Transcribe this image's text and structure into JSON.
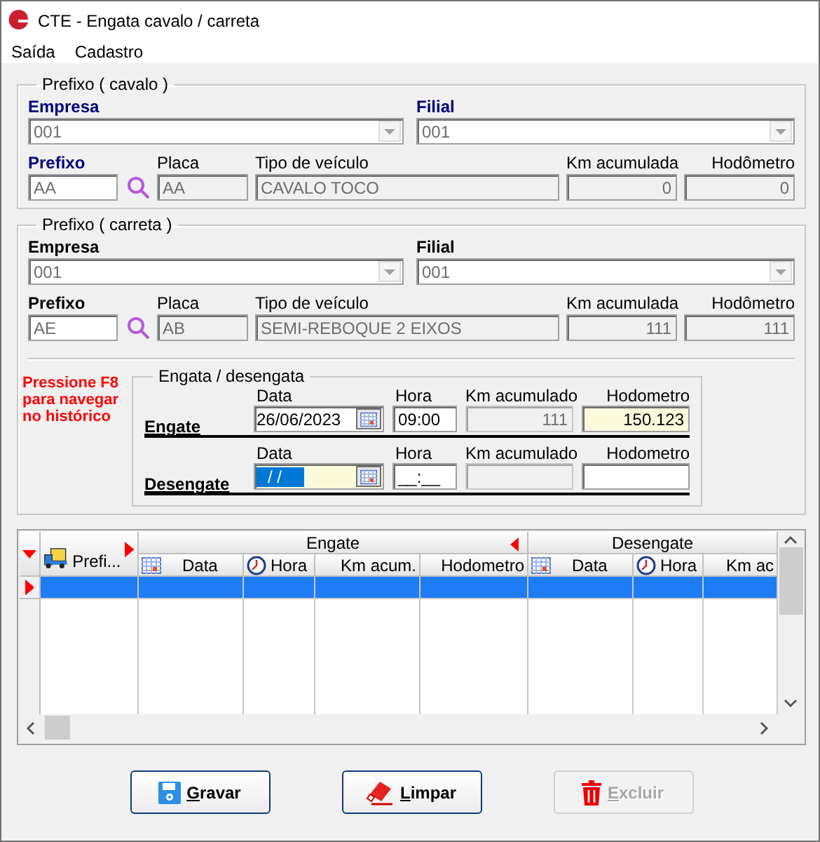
{
  "window": {
    "title": "CTE - Engata cavalo / carreta"
  },
  "menu": [
    {
      "label": "Saída"
    },
    {
      "label": "Cadastro"
    }
  ],
  "sections": [
    {
      "legend": "Prefixo ( cavalo )",
      "color": "#000080",
      "empresa": {
        "label": "Empresa",
        "value": "001",
        "required": true
      },
      "filial": {
        "label": "Filial",
        "value": "001",
        "required": true
      },
      "prefixo": {
        "label": "Prefixo",
        "value": "AA",
        "required": true,
        "editable": true
      },
      "placa": {
        "label": "Placa",
        "value": "AA",
        "required": false,
        "editable": false
      },
      "tipo_veiculo": {
        "label": "Tipo de veículo",
        "value": "CAVALO TOCO",
        "required": false,
        "editable": false
      },
      "km_acumulada": {
        "label": "Km acumulada",
        "value": "0",
        "required": false,
        "editable": false
      },
      "hodometro": {
        "label": "Hodômetro",
        "value": "0",
        "required": false,
        "editable": false
      }
    },
    {
      "legend": "Prefixo ( carreta )",
      "color": "#000000",
      "empresa": {
        "label": "Empresa",
        "value": "001",
        "required": true
      },
      "filial": {
        "label": "Filial",
        "value": "001",
        "required": true
      },
      "prefixo": {
        "label": "Prefixo",
        "value": "AE",
        "required": true,
        "editable": true
      },
      "placa": {
        "label": "Placa",
        "value": "AB",
        "required": false,
        "editable": false
      },
      "tipo_veiculo": {
        "label": "Tipo de veículo",
        "value": "SEMI-REBOQUE 2 EIXOS",
        "required": false,
        "editable": false
      },
      "km_acumulada": {
        "label": "Km acumulada",
        "value": "111",
        "required": false,
        "editable": false
      },
      "hodometro": {
        "label": "Hodômetro",
        "value": "111",
        "required": false,
        "editable": false
      }
    }
  ],
  "hint": "Pressione F8 para navegar no histórico",
  "engata": {
    "legend": "Engata / desengata",
    "rows": [
      {
        "title": "Engate",
        "fields": [
          {
            "kind": "date",
            "label": "Data",
            "value": "26/06/2023",
            "highlighted": false,
            "selected": false
          },
          {
            "kind": "time",
            "label": "Hora",
            "value": "09:00",
            "highlighted": false
          },
          {
            "kind": "number",
            "label": "Km acumulado",
            "value": "111",
            "editable": false
          },
          {
            "kind": "number",
            "label": "Hodometro",
            "value": "150.123",
            "editable": true,
            "highlighted": true
          }
        ]
      },
      {
        "title": "Desengate",
        "fields": [
          {
            "kind": "date",
            "label": "Data",
            "value": "/ /",
            "highlighted": true,
            "selected": true
          },
          {
            "kind": "time",
            "label": "Hora",
            "value": "__:__",
            "highlighted": false
          },
          {
            "kind": "number",
            "label": "Km acumulado",
            "editable": false
          },
          {
            "kind": "number",
            "label": "Hodometro",
            "editable": true,
            "highlighted": false
          }
        ]
      }
    ]
  },
  "grid": {
    "key_column": {
      "label": "Prefi..."
    },
    "groups": [
      {
        "label": "Engate",
        "columns": [
          {
            "label": "Data",
            "kind": "date"
          },
          {
            "label": "Hora",
            "kind": "time"
          },
          {
            "label": "Km acum.",
            "kind": "number"
          },
          {
            "label": "Hodometro",
            "kind": "number"
          }
        ]
      },
      {
        "label": "Desengate",
        "columns": [
          {
            "label": "Data",
            "kind": "date"
          },
          {
            "label": "Hora",
            "kind": "time"
          },
          {
            "label": "Km ac",
            "kind": "number"
          }
        ]
      }
    ],
    "rows": [
      {
        "selected": true
      }
    ]
  },
  "buttons": [
    {
      "label": "Gravar",
      "kind": "save",
      "disabled": false
    },
    {
      "label": "Limpar",
      "kind": "clear",
      "disabled": false
    },
    {
      "label": "Excluir",
      "kind": "delete",
      "disabled": true
    }
  ]
}
